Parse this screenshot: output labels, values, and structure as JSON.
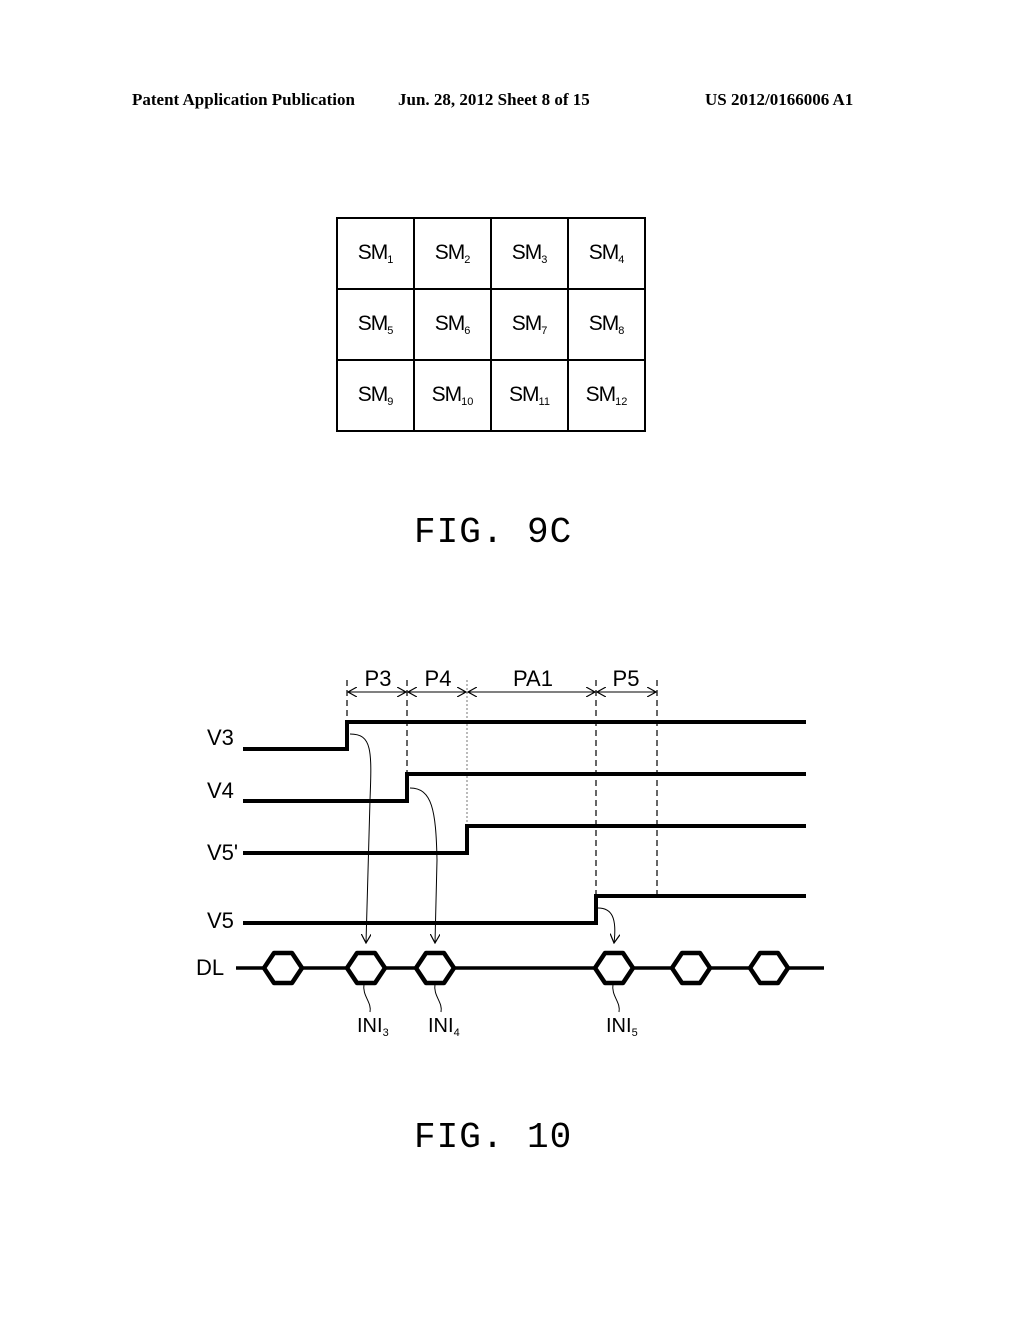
{
  "header": {
    "left": "Patent Application Publication",
    "middle": "Jun. 28, 2012  Sheet 8 of 15",
    "right": "US 2012/0166006 A1"
  },
  "fig9c": {
    "label": "FIG. 9C",
    "cells": [
      [
        {
          "base": "SM",
          "sub": "1"
        },
        {
          "base": "SM",
          "sub": "2"
        },
        {
          "base": "SM",
          "sub": "3"
        },
        {
          "base": "SM",
          "sub": "4"
        }
      ],
      [
        {
          "base": "SM",
          "sub": "5"
        },
        {
          "base": "SM",
          "sub": "6"
        },
        {
          "base": "SM",
          "sub": "7"
        },
        {
          "base": "SM",
          "sub": "8"
        }
      ],
      [
        {
          "base": "SM",
          "sub": "9"
        },
        {
          "base": "SM",
          "sub": "10"
        },
        {
          "base": "SM",
          "sub": "11"
        },
        {
          "base": "SM",
          "sub": "12"
        }
      ]
    ]
  },
  "fig10": {
    "label": "FIG. 10",
    "periods": [
      "P3",
      "P4",
      "PA1",
      "P5"
    ],
    "signals": [
      "V3",
      "V4",
      "V5'",
      "V5",
      "DL"
    ],
    "init_labels": [
      {
        "base": "INI",
        "sub": "3"
      },
      {
        "base": "INI",
        "sub": "4"
      },
      {
        "base": "INI",
        "sub": "5"
      }
    ]
  }
}
